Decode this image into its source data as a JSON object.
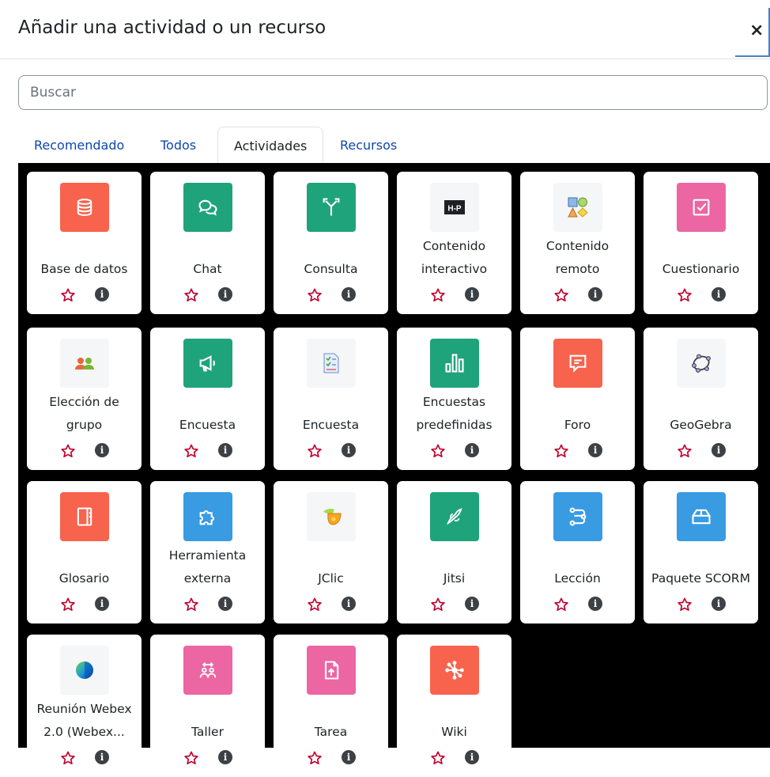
{
  "dialog": {
    "title": "Añadir una actividad o un recurso",
    "close_label": "×"
  },
  "search": {
    "placeholder": "Buscar",
    "value": ""
  },
  "tabs": [
    {
      "label": "Recomendado",
      "active": false
    },
    {
      "label": "Todos",
      "active": false
    },
    {
      "label": "Actividades",
      "active": true
    },
    {
      "label": "Recursos",
      "active": false
    }
  ],
  "info_label": "i",
  "colors": {
    "salmon": "#f7634d",
    "green": "#1fa37a",
    "blue": "#399be2",
    "pink": "#eb66a2",
    "neutral": "#f5f6f8",
    "link": "#0f47ad",
    "star": "#c0002b"
  },
  "items": [
    {
      "label": "Base de datos",
      "icon": "database-icon",
      "color": "salmon"
    },
    {
      "label": "Chat",
      "icon": "chat-icon",
      "color": "green"
    },
    {
      "label": "Consulta",
      "icon": "choice-icon",
      "color": "green"
    },
    {
      "label": "Contenido interactivo",
      "icon": "h5p-icon",
      "color": "neutral"
    },
    {
      "label": "Contenido remoto",
      "icon": "shapes-icon",
      "color": "neutral"
    },
    {
      "label": "Cuestionario",
      "icon": "quiz-icon",
      "color": "pink"
    },
    {
      "label": "Elección de grupo",
      "icon": "group-choice-icon",
      "color": "neutral"
    },
    {
      "label": "Encuesta",
      "icon": "megaphone-icon",
      "color": "green"
    },
    {
      "label": "Encuesta",
      "icon": "questionnaire-icon",
      "color": "neutral"
    },
    {
      "label": "Encuestas predefinidas",
      "icon": "bar-chart-icon",
      "color": "green"
    },
    {
      "label": "Foro",
      "icon": "forum-icon",
      "color": "salmon"
    },
    {
      "label": "GeoGebra",
      "icon": "geogebra-icon",
      "color": "neutral"
    },
    {
      "label": "Glosario",
      "icon": "glossary-icon",
      "color": "salmon"
    },
    {
      "label": "Herramienta externa",
      "icon": "puzzle-icon",
      "color": "blue"
    },
    {
      "label": "JClic",
      "icon": "jclic-icon",
      "color": "neutral"
    },
    {
      "label": "Jitsi",
      "icon": "jitsi-icon",
      "color": "green"
    },
    {
      "label": "Lección",
      "icon": "lesson-icon",
      "color": "blue"
    },
    {
      "label": "Paquete SCORM",
      "icon": "scorm-icon",
      "color": "blue"
    },
    {
      "label": "Reunión Webex 2.0 (Webex...",
      "icon": "webex-icon",
      "color": "neutral"
    },
    {
      "label": "Taller",
      "icon": "workshop-icon",
      "color": "pink"
    },
    {
      "label": "Tarea",
      "icon": "assignment-icon",
      "color": "pink"
    },
    {
      "label": "Wiki",
      "icon": "wiki-icon",
      "color": "salmon"
    }
  ]
}
